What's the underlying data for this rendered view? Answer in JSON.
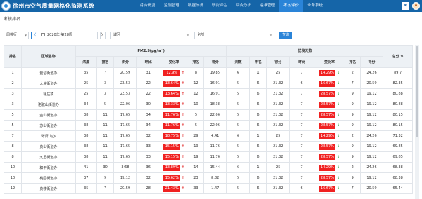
{
  "app": {
    "title": "徐州市空气质量网格化监测系统"
  },
  "nav": [
    "综合概览",
    "监测管理",
    "数据分析",
    "研判评估",
    "综合分析",
    "运维管理",
    "考核评价",
    "业务系统"
  ],
  "nav_active_index": 6,
  "page_title": "考核排名",
  "filters": {
    "period": "周排行",
    "prev_label": "〈",
    "date": "2020年-第28周",
    "next_label": "〉",
    "area": "城区",
    "scope": "全部",
    "search_label": "查询"
  },
  "table": {
    "headers_top": {
      "rank": "排名",
      "region": "区域名称",
      "pm25": "PM2.5(μg/m³)",
      "good_days": "优良天数",
      "total": "总分"
    },
    "headers_sub": [
      "浓度",
      "排名",
      "得分",
      "环比",
      "变化率",
      "排名",
      "得分",
      "天数",
      "排名",
      "得分",
      "环比",
      "变化率",
      "排名",
      "得分"
    ],
    "rows": [
      {
        "rank": "1",
        "region": "琵琶街道办",
        "conc": "35",
        "conc_rank": "7",
        "conc_score": "20.59",
        "mom": "31",
        "rate": "12.9%",
        "dir": "up",
        "rate_rank": "8",
        "rate_score": "19.85",
        "days": "6",
        "days_rank": "1",
        "days_score": "25",
        "days_mom": "7",
        "days_rate": "14.29%",
        "days_dir": "down",
        "days_rate_rank": "2",
        "days_rate_score": "24.26",
        "total": "89.7"
      },
      {
        "rank": "2",
        "region": "大庙街道办",
        "conc": "25",
        "conc_rank": "3",
        "conc_score": "23.53",
        "mom": "22",
        "rate": "13.64%",
        "dir": "up",
        "rate_rank": "12",
        "rate_score": "16.91",
        "days": "5",
        "days_rank": "6",
        "days_score": "21.32",
        "days_mom": "6",
        "days_rate": "16.67%",
        "days_dir": "down",
        "days_rate_rank": "7",
        "days_rate_score": "20.59",
        "total": "82.35"
      },
      {
        "rank": "3",
        "region": "徐庄镇",
        "conc": "25",
        "conc_rank": "3",
        "conc_score": "23.53",
        "mom": "22",
        "rate": "13.64%",
        "dir": "up",
        "rate_rank": "12",
        "rate_score": "16.91",
        "days": "5",
        "days_rank": "6",
        "days_score": "21.32",
        "days_mom": "7",
        "days_rate": "28.57%",
        "days_dir": "down",
        "days_rate_rank": "9",
        "days_rate_score": "19.12",
        "total": "80.88"
      },
      {
        "rank": "3",
        "region": "骆驼山街道办",
        "conc": "34",
        "conc_rank": "5",
        "conc_score": "22.06",
        "mom": "30",
        "rate": "13.33%",
        "dir": "up",
        "rate_rank": "10",
        "rate_score": "18.38",
        "days": "5",
        "days_rank": "6",
        "days_score": "21.32",
        "days_mom": "7",
        "days_rate": "28.57%",
        "days_dir": "down",
        "days_rate_rank": "9",
        "days_rate_score": "19.12",
        "total": "80.88"
      },
      {
        "rank": "5",
        "region": "金山街道办",
        "conc": "38",
        "conc_rank": "11",
        "conc_score": "17.65",
        "mom": "34",
        "rate": "11.76%",
        "dir": "up",
        "rate_rank": "5",
        "rate_score": "22.06",
        "days": "5",
        "days_rank": "6",
        "days_score": "21.32",
        "days_mom": "7",
        "days_rate": "28.57%",
        "days_dir": "down",
        "days_rate_rank": "9",
        "days_rate_score": "19.12",
        "total": "80.15"
      },
      {
        "rank": "5",
        "region": "苏山街道办",
        "conc": "38",
        "conc_rank": "11",
        "conc_score": "17.65",
        "mom": "34",
        "rate": "11.76%",
        "dir": "up",
        "rate_rank": "5",
        "rate_score": "22.06",
        "days": "5",
        "days_rank": "6",
        "days_score": "21.32",
        "days_mom": "7",
        "days_rate": "28.57%",
        "days_dir": "down",
        "days_rate_rank": "9",
        "days_rate_score": "19.12",
        "total": "80.15"
      },
      {
        "rank": "7",
        "region": "翠屏山办",
        "conc": "38",
        "conc_rank": "11",
        "conc_score": "17.65",
        "mom": "32",
        "rate": "18.75%",
        "dir": "up",
        "rate_rank": "29",
        "rate_score": "4.41",
        "days": "6",
        "days_rank": "1",
        "days_score": "25",
        "days_mom": "7",
        "days_rate": "14.29%",
        "days_dir": "down",
        "days_rate_rank": "2",
        "days_rate_score": "24.26",
        "total": "71.32"
      },
      {
        "rank": "8",
        "region": "黄山街道办",
        "conc": "38",
        "conc_rank": "11",
        "conc_score": "17.65",
        "mom": "33",
        "rate": "15.15%",
        "dir": "up",
        "rate_rank": "19",
        "rate_score": "11.76",
        "days": "5",
        "days_rank": "6",
        "days_score": "21.32",
        "days_mom": "7",
        "days_rate": "28.57%",
        "days_dir": "down",
        "days_rate_rank": "9",
        "days_rate_score": "19.12",
        "total": "69.85"
      },
      {
        "rank": "8",
        "region": "九里街道办",
        "conc": "38",
        "conc_rank": "11",
        "conc_score": "17.65",
        "mom": "33",
        "rate": "15.15%",
        "dir": "up",
        "rate_rank": "19",
        "rate_score": "11.76",
        "days": "5",
        "days_rank": "6",
        "days_score": "21.32",
        "days_mom": "7",
        "days_rate": "28.57%",
        "days_dir": "down",
        "days_rate_rank": "9",
        "days_rate_score": "19.12",
        "total": "69.85"
      },
      {
        "rank": "10",
        "region": "和平街道办",
        "conc": "41",
        "conc_rank": "30",
        "conc_score": "3.68",
        "mom": "36",
        "rate": "13.89%",
        "dir": "up",
        "rate_rank": "14",
        "rate_score": "15.44",
        "days": "6",
        "days_rank": "1",
        "days_score": "25",
        "days_mom": "7",
        "days_rate": "14.29%",
        "days_dir": "down",
        "days_rate_rank": "2",
        "days_rate_score": "24.26",
        "total": "68.38"
      },
      {
        "rank": "10",
        "region": "桃园街道办",
        "conc": "37",
        "conc_rank": "9",
        "conc_score": "19.12",
        "mom": "32",
        "rate": "15.62%",
        "dir": "up",
        "rate_rank": "23",
        "rate_score": "8.82",
        "days": "5",
        "days_rank": "6",
        "days_score": "21.32",
        "days_mom": "7",
        "days_rate": "28.57%",
        "days_dir": "down",
        "days_rate_rank": "9",
        "days_rate_score": "19.12",
        "total": "68.38"
      },
      {
        "rank": "12",
        "region": "黄楼街道办",
        "conc": "35",
        "conc_rank": "7",
        "conc_score": "20.59",
        "mom": "28",
        "rate": "21.43%",
        "dir": "up",
        "rate_rank": "33",
        "rate_score": "1.47",
        "days": "5",
        "days_rank": "6",
        "days_score": "21.32",
        "days_mom": "6",
        "days_rate": "16.67%",
        "days_dir": "down",
        "days_rate_rank": "7",
        "days_rate_score": "20.59",
        "total": "65.44"
      }
    ]
  },
  "colors": {
    "header_bar": "#1565a8",
    "nav_active": "#2a84d8",
    "rate_cell": "#f02121",
    "arrow_up": "#e02020",
    "arrow_down": "#2c9a3a"
  }
}
